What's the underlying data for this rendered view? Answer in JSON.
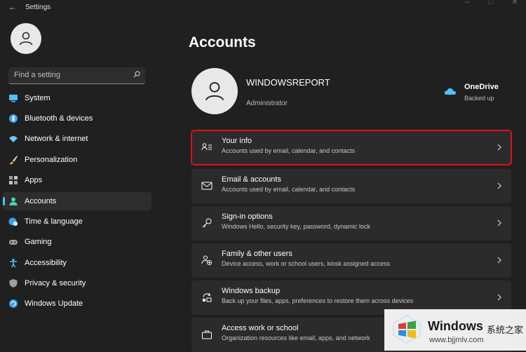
{
  "titlebar": {
    "title": "Settings",
    "back_icon": "arrow-left-icon"
  },
  "search": {
    "placeholder": "Find a setting",
    "icon": "search-icon"
  },
  "nav": {
    "items": [
      {
        "label": "System",
        "icon": "monitor-icon",
        "color": "#4cc2ff",
        "selected": false
      },
      {
        "label": "Bluetooth & devices",
        "icon": "bluetooth-icon",
        "color": "#3aa0f0",
        "selected": false
      },
      {
        "label": "Network & internet",
        "icon": "wifi-icon",
        "color": "#6cc7ff",
        "selected": false
      },
      {
        "label": "Personalization",
        "icon": "brush-icon",
        "color": "#f0a860",
        "selected": false
      },
      {
        "label": "Apps",
        "icon": "apps-icon",
        "color": "#9aa0a6",
        "selected": false
      },
      {
        "label": "Accounts",
        "icon": "person-icon",
        "color": "#4cd2b0",
        "selected": true
      },
      {
        "label": "Time & language",
        "icon": "globe-clock-icon",
        "color": "#3aa0f0",
        "selected": false
      },
      {
        "label": "Gaming",
        "icon": "gamepad-icon",
        "color": "#a0a0a0",
        "selected": false
      },
      {
        "label": "Accessibility",
        "icon": "accessibility-icon",
        "color": "#4cc2ff",
        "selected": false
      },
      {
        "label": "Privacy & security",
        "icon": "shield-icon",
        "color": "#9aa0a6",
        "selected": false
      },
      {
        "label": "Windows Update",
        "icon": "update-icon",
        "color": "#3aa0f0",
        "selected": false
      }
    ]
  },
  "main": {
    "title": "Accounts",
    "profile": {
      "name": "WINDOWSREPORT",
      "role": "Administrator"
    },
    "onedrive": {
      "name": "OneDrive",
      "status": "Backed up",
      "icon": "cloud-icon"
    },
    "cards": [
      {
        "title": "Your info",
        "desc": "Accounts used by email, calendar, and contacts",
        "icon": "person-card-icon",
        "highlighted": true
      },
      {
        "title": "Email & accounts",
        "desc": "Accounts used by email, calendar, and contacts",
        "icon": "mail-icon",
        "highlighted": false
      },
      {
        "title": "Sign-in options",
        "desc": "Windows Hello, security key, password, dynamic lock",
        "icon": "key-icon",
        "highlighted": false
      },
      {
        "title": "Family & other users",
        "desc": "Device access, work or school users, kiosk assigned access",
        "icon": "family-icon",
        "highlighted": false
      },
      {
        "title": "Windows backup",
        "desc": "Back up your files, apps, preferences to restore them across devices",
        "icon": "backup-icon",
        "highlighted": false
      },
      {
        "title": "Access work or school",
        "desc": "Organization resources like email, apps, and network",
        "icon": "briefcase-icon",
        "highlighted": false
      }
    ]
  },
  "watermark": {
    "brand": "Windows",
    "cn": "系统之家",
    "url": "www.bjjmlv.com"
  },
  "colors": {
    "accent": "#4cc2ff",
    "highlight": "#e0101c",
    "background": "#202020",
    "card": "#2b2b2b"
  }
}
